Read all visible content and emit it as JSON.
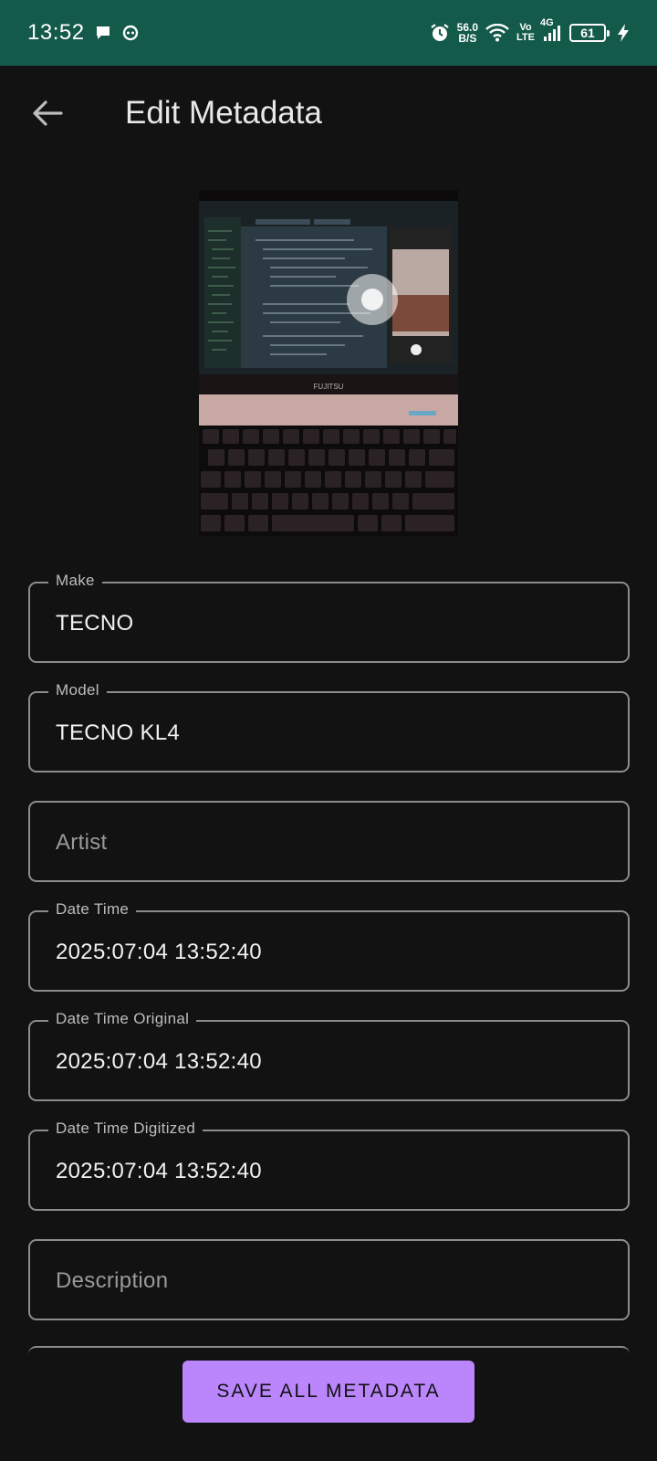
{
  "status_bar": {
    "time": "13:52",
    "net_speed_value": "56.0",
    "net_speed_unit": "B/S",
    "volte_top": "Vo",
    "volte_bottom": "LTE",
    "network_type": "4G",
    "battery": "61",
    "icons": [
      "message-icon",
      "notification-app-icon",
      "alarm-icon",
      "wifi-icon",
      "signal-icon",
      "battery-icon",
      "charging-icon"
    ]
  },
  "app_bar": {
    "title": "Edit Metadata",
    "back_icon": "arrow-left-icon"
  },
  "photo": {
    "subject": "laptop screen and keyboard photo",
    "brand_text": "FUJITSU"
  },
  "fields": {
    "make": {
      "label": "Make",
      "value": "TECNO"
    },
    "model": {
      "label": "Model",
      "value": "TECNO KL4"
    },
    "artist": {
      "placeholder": "Artist",
      "value": ""
    },
    "date_time": {
      "label": "Date Time",
      "value": "2025:07:04 13:52:40"
    },
    "date_time_original": {
      "label": "Date Time Original",
      "value": "2025:07:04 13:52:40"
    },
    "date_time_digitized": {
      "label": "Date Time Digitized",
      "value": "2025:07:04 13:52:40"
    },
    "description": {
      "placeholder": "Description",
      "value": ""
    }
  },
  "save_button": {
    "label": "SAVE ALL METADATA"
  },
  "colors": {
    "status_bar": "#135a4a",
    "background": "#121212",
    "field_border": "#8c8c8c",
    "accent": "#bb86fc"
  }
}
